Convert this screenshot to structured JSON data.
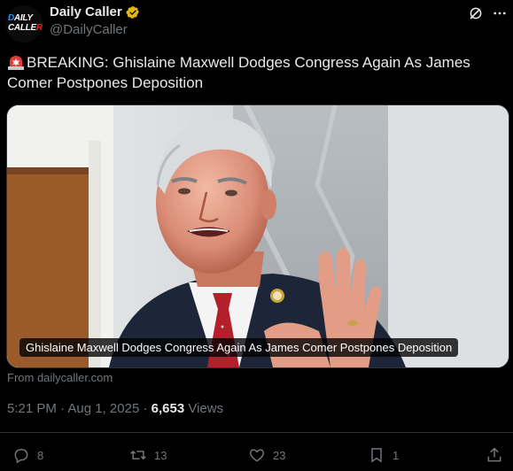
{
  "author": {
    "display_name": "Daily Caller",
    "handle": "@DailyCaller",
    "avatar_line1_a": "D",
    "avatar_line1_b": "AILY",
    "avatar_line2_a": "CALLE",
    "avatar_line2_b": "R",
    "verified_icon": "verified-badge-gold",
    "verified_color": "#e2b719"
  },
  "header_icons": [
    "grok-icon",
    "more-icon"
  ],
  "tweet": {
    "emoji": "siren-emoji",
    "text": "BREAKING: Ghislaine Maxwell Dodges Congress Again As James Comer Postpones Deposition"
  },
  "card": {
    "caption": "Ghislaine Maxwell Dodges Congress Again As James Comer Postpones Deposition",
    "source": "From dailycaller.com"
  },
  "meta": {
    "time": "5:21 PM",
    "separator": " · ",
    "date": "Aug 1, 2025",
    "views_count": "6,653",
    "views_label": " Views"
  },
  "actions": {
    "replies": "8",
    "retweets": "13",
    "likes": "23",
    "bookmarks": "1"
  },
  "colors": {
    "background": "#000000",
    "text_primary": "#e7e9ea",
    "text_secondary": "#71767b",
    "border": "#2f3336"
  }
}
